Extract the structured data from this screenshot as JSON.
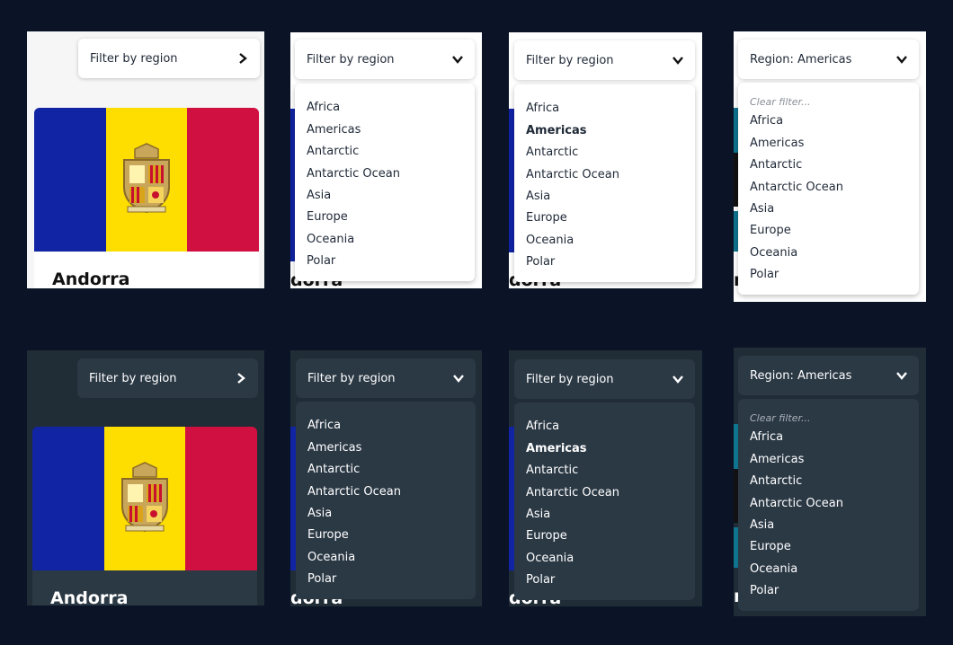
{
  "filter": {
    "placeholder": "Filter by region",
    "selected": "Region: Americas"
  },
  "regions": [
    "Africa",
    "Americas",
    "Antarctic",
    "Antarctic Ocean",
    "Asia",
    "Europe",
    "Oceania",
    "Polar"
  ],
  "highlighted_region": "Americas",
  "clear_filter": "Clear filter...",
  "country": {
    "name": "Andorra"
  },
  "peek_text": "dorra",
  "peek_text_short": "r",
  "colors": {
    "page_bg": "#0b1427",
    "light_panel": "#f6f6f7",
    "dark_panel": "#202c36",
    "dark_element": "#2b3945",
    "flag_blue": "#1024a4",
    "flag_yellow": "#fedd00",
    "flag_red": "#d01040"
  }
}
